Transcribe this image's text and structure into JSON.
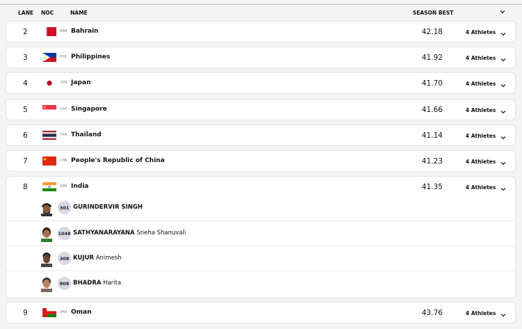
{
  "header": {
    "lane": "LANE",
    "noc": "NOC",
    "name": "NAME",
    "season_best": "SEASON BEST"
  },
  "rows": [
    {
      "lane": "2",
      "noc": "BRN",
      "country": "Bahrain",
      "season_best": "42.18",
      "athletes_label": "4 Athletes",
      "flag": "bahrain-flag-icon"
    },
    {
      "lane": "3",
      "noc": "PHI",
      "country": "Philippines",
      "season_best": "41.92",
      "athletes_label": "4 Athletes",
      "flag": "philippines-flag-icon"
    },
    {
      "lane": "4",
      "noc": "JPN",
      "country": "Japan",
      "season_best": "41.70",
      "athletes_label": "4 Athletes",
      "flag": "japan-flag-icon"
    },
    {
      "lane": "5",
      "noc": "SGP",
      "country": "Singapore",
      "season_best": "41.66",
      "athletes_label": "4 Athletes",
      "flag": "singapore-flag-icon"
    },
    {
      "lane": "6",
      "noc": "THA",
      "country": "Thailand",
      "season_best": "41.14",
      "athletes_label": "4 Athletes",
      "flag": "thailand-flag-icon"
    },
    {
      "lane": "7",
      "noc": "CHN",
      "country": "People's Republic of China",
      "season_best": "41.23",
      "athletes_label": "4 Athletes",
      "flag": "china-flag-icon"
    },
    {
      "lane": "8",
      "noc": "IND",
      "country": "India",
      "season_best": "41.35",
      "athletes_label": "4 Athletes",
      "flag": "india-flag-icon",
      "athletes": [
        {
          "bib": "301",
          "last": "GURINDERVIR SINGH",
          "first": ""
        },
        {
          "bib": "1048",
          "last": "SATHYANARAYANA",
          "first": "Sneha Shanuvali"
        },
        {
          "bib": "308",
          "last": "KUJUR",
          "first": "Animesh"
        },
        {
          "bib": "808",
          "last": "BHADRA",
          "first": "Harita"
        }
      ]
    },
    {
      "lane": "9",
      "noc": "OMA",
      "country": "Oman",
      "season_best": "43.76",
      "athletes_label": "4 Athletes",
      "flag": "oman-flag-icon"
    }
  ]
}
